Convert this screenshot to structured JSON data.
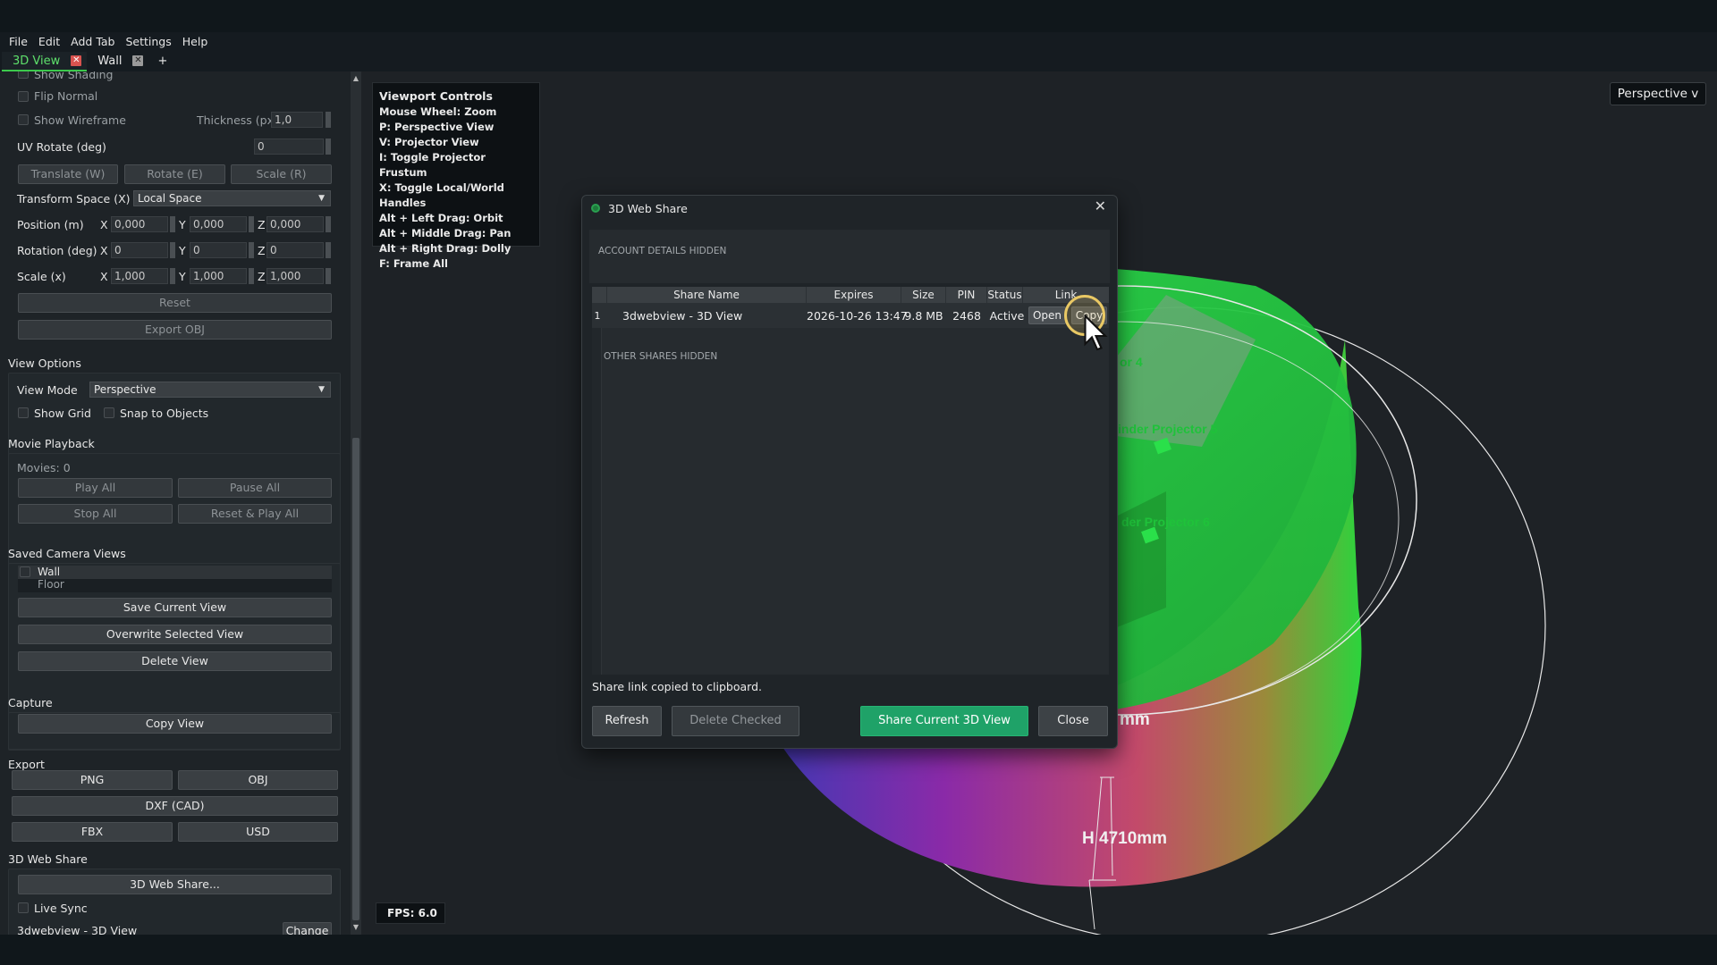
{
  "menubar": {
    "items": [
      "File",
      "Edit",
      "Add Tab",
      "Settings",
      "Help"
    ]
  },
  "tabs": [
    {
      "label": "3D View",
      "close": "✕"
    },
    {
      "label": "Wall",
      "close": "✕"
    },
    {
      "label": "+"
    }
  ],
  "left": {
    "show_shading": "Show Shading",
    "flip_normal": "Flip Normal",
    "show_wireframe": "Show Wireframe",
    "thickness_label": "Thickness (px)",
    "thickness_value": "1,0",
    "uv_rotate_label": "UV Rotate (deg)",
    "uv_rotate_value": "0",
    "translate": "Translate (W)",
    "rotate": "Rotate (E)",
    "scale": "Scale (R)",
    "transform_space_label": "Transform Space (X)",
    "transform_space_value": "Local Space",
    "position_label": "Position (m)",
    "rotation_label": "Rotation (deg)",
    "scale_label": "Scale (x)",
    "axis_x": "X",
    "axis_y": "Y",
    "axis_z": "Z",
    "position": [
      "0,000",
      "0,000",
      "0,000"
    ],
    "rotation": [
      "0",
      "0",
      "0"
    ],
    "scale_vals": [
      "1,000",
      "1,000",
      "1,000"
    ],
    "reset": "Reset",
    "export_obj": "Export OBJ",
    "view_options": "View Options",
    "view_mode_label": "View Mode",
    "view_mode_value": "Perspective",
    "show_grid": "Show Grid",
    "snap_to_objects": "Snap to Objects",
    "movie_playback": "Movie Playback",
    "movies": "Movies: 0",
    "play_all": "Play All",
    "pause_all": "Pause All",
    "stop_all": "Stop All",
    "reset_play_all": "Reset & Play All",
    "saved_camera_views": "Saved Camera Views",
    "views": [
      "Wall",
      "Floor"
    ],
    "save_current_view": "Save Current View",
    "overwrite_selected_view": "Overwrite Selected View",
    "delete_view": "Delete View",
    "capture": "Capture",
    "copy_view": "Copy View",
    "export": "Export",
    "png": "PNG",
    "obj": "OBJ",
    "dxf": "DXF (CAD)",
    "fbx": "FBX",
    "usd": "USD",
    "web_share_section": "3D Web Share",
    "web_share_btn": "3D Web Share...",
    "live_sync": "Live Sync",
    "share_name": "3dwebview - 3D View",
    "change": "Change"
  },
  "viewport": {
    "controls_title": "Viewport Controls",
    "controls": [
      "Mouse Wheel: Zoom",
      "P: Perspective View",
      "V: Projector View",
      "I: Toggle Projector Frustum",
      "X: Toggle Local/World Handles",
      "Alt + Left Drag: Orbit",
      "Alt + Middle Drag: Pan",
      "Alt + Right Drag: Dolly",
      "F: Frame All"
    ],
    "perspective_btn": "Perspective v",
    "fps": "FPS: 6.0",
    "labels": {
      "proj4": "or 4",
      "proj5": "inder Projector 5",
      "proj6": "der Projector 6",
      "mm": "mm",
      "height": "H 4710mm"
    }
  },
  "dialog": {
    "title": "3D Web Share",
    "close": "✕",
    "account_hidden": "ACCOUNT DETAILS HIDDEN",
    "columns": [
      "Share Name",
      "Expires",
      "Size",
      "PIN",
      "Status",
      "Link"
    ],
    "row": {
      "num": "1",
      "name": "3dwebview - 3D View",
      "expires": "2026-10-26 13:47",
      "size": "9.8 MB",
      "pin": "2468",
      "status": "Active",
      "open": "Open",
      "copy": "Copy"
    },
    "other_hidden": "OTHER SHARES HIDDEN",
    "message": "Share link copied to clipboard.",
    "refresh": "Refresh",
    "delete_checked": "Delete Checked",
    "share_current": "Share Current 3D View",
    "close_btn": "Close"
  },
  "colors": {
    "accent_green": "#1fa268",
    "tab_active": "#5ee06b"
  }
}
